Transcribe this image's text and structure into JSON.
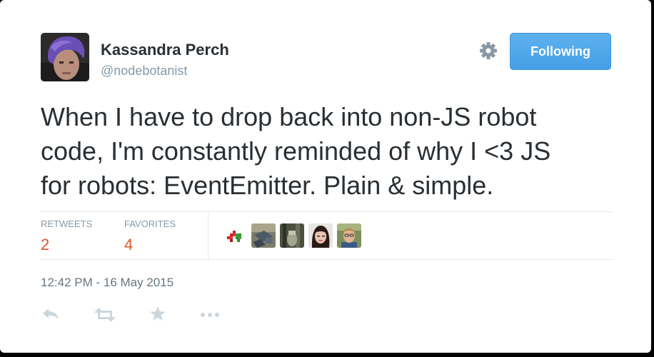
{
  "author": {
    "name": "Kassandra Perch",
    "handle": "@nodebotanist"
  },
  "follow_button": {
    "label": "Following",
    "color": "#55acee"
  },
  "tweet": {
    "lines": [
      "When I have to drop back into non-JS robot",
      "code, I'm constantly reminded of why I <3 JS",
      "for robots: EventEmitter. Plain & simple."
    ]
  },
  "stats": {
    "retweets": {
      "label": "RETWEETS",
      "count": "2"
    },
    "favorites": {
      "label": "FAVORITES",
      "count": "4"
    },
    "count_color": "#e1562b"
  },
  "favoriters": [
    "robot-sprite-avatar",
    "tabletop-photo-avatar",
    "forest-photo-avatar",
    "woman-portrait-avatar",
    "man-portrait-avatar"
  ],
  "timestamp": "12:42 PM - 16 May 2015",
  "actions": [
    "reply-icon",
    "retweet-icon",
    "favorite-icon",
    "more-icon"
  ]
}
